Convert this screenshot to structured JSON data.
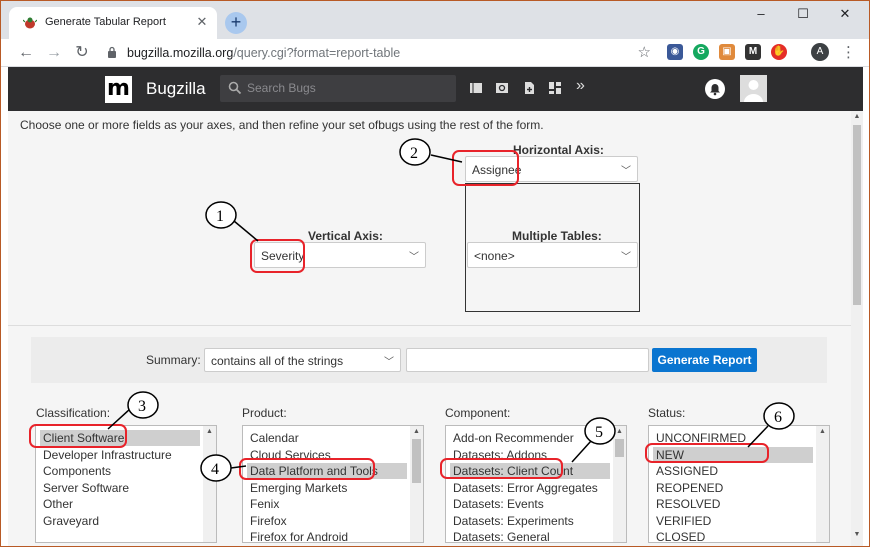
{
  "browser": {
    "tab_title": "Generate Tabular Report",
    "new_tab_symbol": "+",
    "url_host": "bugzilla.mozilla.org",
    "url_path": "/query.cgi?format=report-table",
    "profile_initial": "A"
  },
  "header": {
    "app_name": "Bugzilla",
    "logo_letter": "m",
    "search_placeholder": "Search Bugs"
  },
  "form": {
    "intro": "Choose one or more fields as your axes, and then refine your set ofbugs using the rest of the form.",
    "horizontal_axis": {
      "label": "Horizontal Axis:",
      "value": "Assignee"
    },
    "vertical_axis": {
      "label": "Vertical Axis:",
      "value": "Severity"
    },
    "multiple_tables": {
      "label": "Multiple Tables:",
      "value": "<none>"
    },
    "summary": {
      "label": "Summary:",
      "operator": "contains all of the strings",
      "text_value": "",
      "button": "Generate Report"
    }
  },
  "lists": {
    "classification": {
      "label": "Classification:",
      "options": [
        "Client Software",
        "Developer Infrastructure",
        "Components",
        "Server Software",
        "Other",
        "Graveyard"
      ],
      "selected": "Client Software"
    },
    "product": {
      "label": "Product:",
      "options": [
        "Calendar",
        "Cloud Services",
        "Data Platform and Tools",
        "Emerging Markets",
        "Fenix",
        "Firefox",
        "Firefox for Android"
      ],
      "selected": "Data Platform and Tools"
    },
    "component": {
      "label": "Component:",
      "options": [
        "Add-on Recommender",
        "Datasets: Addons",
        "Datasets: Client Count",
        "Datasets: Error Aggregates",
        "Datasets: Events",
        "Datasets: Experiments",
        "Datasets: General"
      ],
      "selected": "Datasets: Client Count"
    },
    "status": {
      "label": "Status:",
      "options": [
        "UNCONFIRMED",
        "NEW",
        "ASSIGNED",
        "REOPENED",
        "RESOLVED",
        "VERIFIED",
        "CLOSED"
      ],
      "selected": "NEW"
    }
  },
  "annotations": {
    "markers": [
      "1",
      "2",
      "3",
      "4",
      "5",
      "6"
    ],
    "highlight_color": "#e8232a"
  },
  "colors": {
    "header_bg": "#2d2d2f",
    "button_blue": "#0a75d0",
    "selection_gray": "#cfcfcf",
    "frame_orange": "#b85a26"
  }
}
